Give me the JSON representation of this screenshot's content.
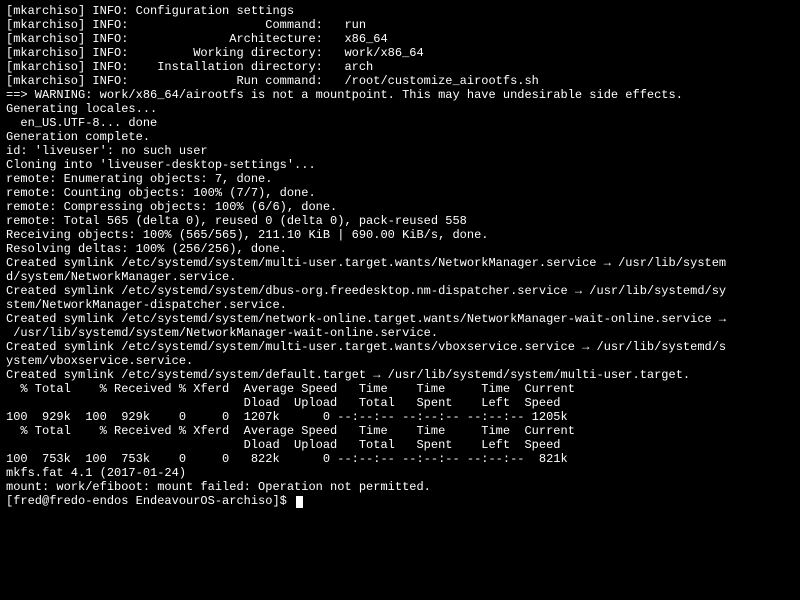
{
  "lines": [
    "[mkarchiso] INFO: Configuration settings",
    "[mkarchiso] INFO:                   Command:   run",
    "[mkarchiso] INFO:              Architecture:   x86_64",
    "[mkarchiso] INFO:         Working directory:   work/x86_64",
    "[mkarchiso] INFO:    Installation directory:   arch",
    "[mkarchiso] INFO:               Run command:   /root/customize_airootfs.sh",
    "",
    "==> WARNING: work/x86_64/airootfs is not a mountpoint. This may have undesirable side effects.",
    "Generating locales...",
    "  en_US.UTF-8... done",
    "Generation complete.",
    "id: 'liveuser': no such user",
    "Cloning into 'liveuser-desktop-settings'...",
    "remote: Enumerating objects: 7, done.",
    "remote: Counting objects: 100% (7/7), done.",
    "remote: Compressing objects: 100% (6/6), done.",
    "remote: Total 565 (delta 0), reused 0 (delta 0), pack-reused 558",
    "Receiving objects: 100% (565/565), 211.10 KiB | 690.00 KiB/s, done.",
    "Resolving deltas: 100% (256/256), done.",
    "Created symlink /etc/systemd/system/multi-user.target.wants/NetworkManager.service → /usr/lib/system",
    "d/system/NetworkManager.service.",
    "Created symlink /etc/systemd/system/dbus-org.freedesktop.nm-dispatcher.service → /usr/lib/systemd/sy",
    "stem/NetworkManager-dispatcher.service.",
    "Created symlink /etc/systemd/system/network-online.target.wants/NetworkManager-wait-online.service →",
    " /usr/lib/systemd/system/NetworkManager-wait-online.service.",
    "Created symlink /etc/systemd/system/multi-user.target.wants/vboxservice.service → /usr/lib/systemd/s",
    "ystem/vboxservice.service.",
    "Created symlink /etc/systemd/system/default.target → /usr/lib/systemd/system/multi-user.target.",
    "  % Total    % Received % Xferd  Average Speed   Time    Time     Time  Current",
    "                                 Dload  Upload   Total   Spent    Left  Speed",
    "100  929k  100  929k    0     0  1207k      0 --:--:-- --:--:-- --:--:-- 1205k",
    "  % Total    % Received % Xferd  Average Speed   Time    Time     Time  Current",
    "                                 Dload  Upload   Total   Spent    Left  Speed",
    "100  753k  100  753k    0     0   822k      0 --:--:-- --:--:-- --:--:--  821k",
    "mkfs.fat 4.1 (2017-01-24)",
    "mount: work/efiboot: mount failed: Operation not permitted.",
    "[fred@fredo-endos EndeavourOS-archiso]$ "
  ],
  "prompt_index": 36
}
